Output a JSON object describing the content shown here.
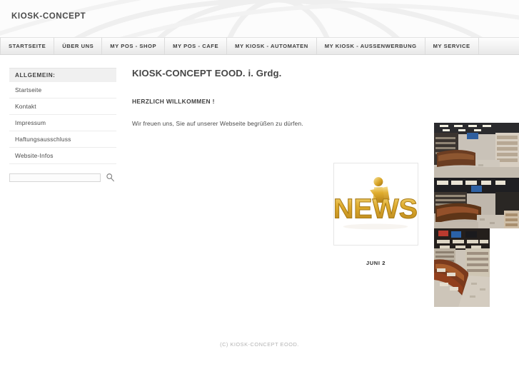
{
  "header": {
    "site_title": "KIOSK-CONCEPT",
    "logo_icon": "globe-arc-watermark"
  },
  "nav": {
    "items": [
      {
        "label": "STARTSEITE"
      },
      {
        "label": "ÜBER UNS"
      },
      {
        "label": "MY POS - SHOP"
      },
      {
        "label": "MY POS - CAFE"
      },
      {
        "label": "MY KIOSK - AUTOMATEN"
      },
      {
        "label": "MY KIOSK - AUSSENWERBUNG"
      },
      {
        "label": "MY SERVICE"
      }
    ]
  },
  "sidebar": {
    "heading": "ALLGEMEIN:",
    "items": [
      {
        "label": "Startseite"
      },
      {
        "label": "Kontakt"
      },
      {
        "label": "Impressum"
      },
      {
        "label": "Haftungsausschluss"
      },
      {
        "label": "Website-Infos"
      }
    ],
    "search": {
      "value": "",
      "placeholder": "",
      "icon": "magnifier-icon"
    }
  },
  "main": {
    "title": "KIOSK-CONCEPT EOOD. i. Grdg.",
    "subtitle": "HERZLICH WILLKOMMEN !",
    "paragraph": "Wir freuen uns, Sie auf unserer Webseite begrüßen zu dürfen."
  },
  "news": {
    "image_alt": "news-gold-3d-graphic",
    "date": "JUNI 2"
  },
  "photos": [
    {
      "alt": "kiosk-interior-counter-and-magazine-wall"
    },
    {
      "alt": "kiosk-interior-wide-counter-view"
    },
    {
      "alt": "kiosk-interior-angled-counter-shelves"
    }
  ],
  "footer": {
    "copyright": "(C) KIOSK-CONCEPT EOOD."
  },
  "colors": {
    "nav_text": "#3d3d3d",
    "title_text": "#464646",
    "body_text": "#4a4a4a",
    "footer_text": "#b4b4b4",
    "news_gold": "#d9a526"
  }
}
